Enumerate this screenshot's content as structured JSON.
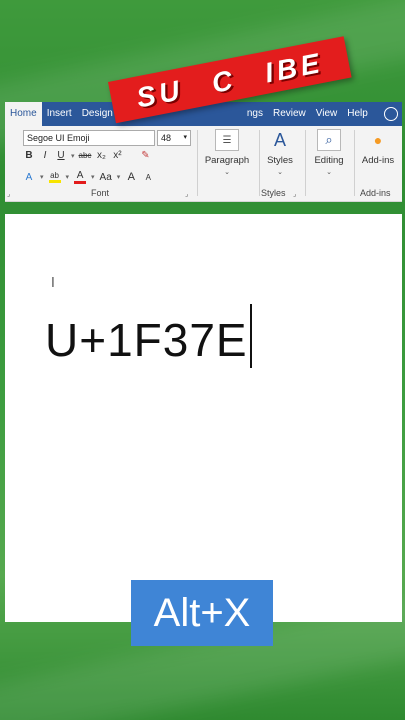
{
  "tabs": [
    {
      "label": "Home",
      "active": true
    },
    {
      "label": "Insert",
      "active": false
    },
    {
      "label": "Design",
      "active": false
    },
    {
      "label": "ngs",
      "active": false
    },
    {
      "label": "Review",
      "active": false
    },
    {
      "label": "View",
      "active": false
    },
    {
      "label": "Help",
      "active": false
    }
  ],
  "font": {
    "name": "Segoe UI Emoji",
    "size": "48",
    "group_label": "Font",
    "bold": "B",
    "italic": "I",
    "underline": "U",
    "strike": "abc",
    "subscript": "x₂",
    "superscript": "x²",
    "text_effects": "A",
    "highlight": "ab",
    "font_color": "A",
    "change_case": "Aa",
    "grow": "A",
    "shrink": "A"
  },
  "groups": {
    "paragraph": "Paragraph",
    "styles": "Styles",
    "styles_group": "Styles",
    "editing": "Editing",
    "addins": "Add-ins",
    "addins_group": "Add-ins"
  },
  "banner": {
    "text": "SU C IBE",
    "color": "#e31d1d"
  },
  "document": {
    "text": "U+1F37E"
  },
  "shortcut": {
    "label": "Alt+X",
    "color": "#3f85d6"
  },
  "colors": {
    "ribbon_blue": "#2b579a",
    "background_green": "#3f9a3c"
  }
}
